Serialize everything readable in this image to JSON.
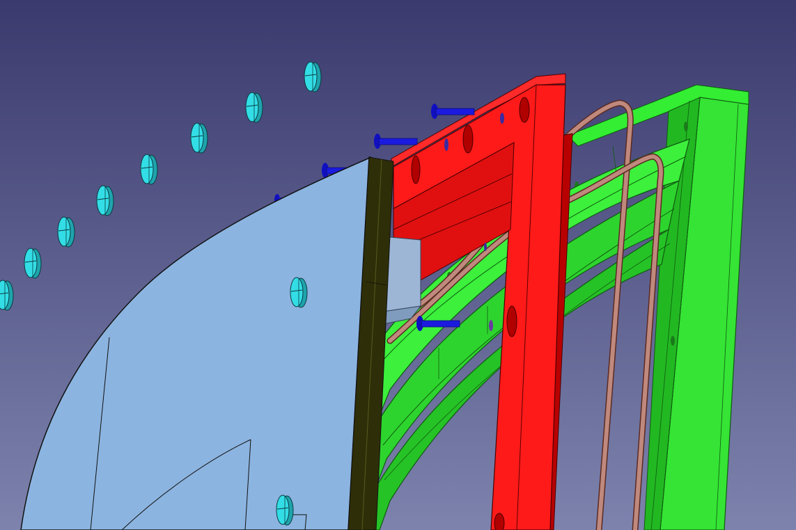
{
  "scene": {
    "kind": "cad-3d-viewport",
    "background_colors": {
      "top": "#3b3a6e",
      "bottom": "#7d83ad"
    },
    "parts": {
      "cover_panel": {
        "color": "#8cb4e0",
        "edge_color": "#2e2e08"
      },
      "insert_block": {
        "color": "#9db6d6"
      },
      "red_flange": {
        "color": "#ff1a1a",
        "shade": "#c40000"
      },
      "green_frame": {
        "color": "#33ee33",
        "shade": "#1a9a1a"
      },
      "copper_pipes": {
        "color": "#b97a6e"
      },
      "bolts": {
        "color": "#1b1be0"
      },
      "rivets": {
        "color": "#33dde6"
      }
    }
  }
}
